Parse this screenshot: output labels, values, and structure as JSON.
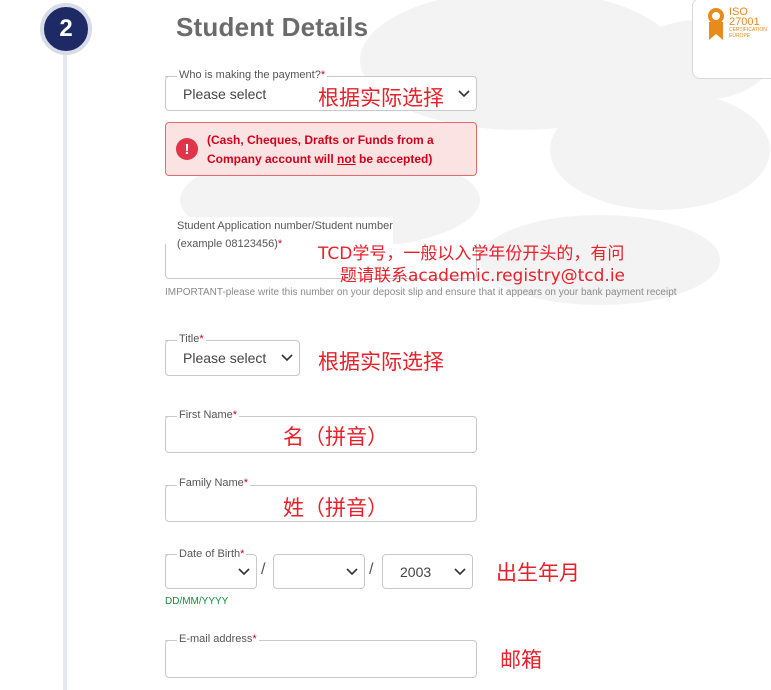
{
  "step": {
    "number": "2",
    "title": "Student Details"
  },
  "iso_badge": {
    "line1": "ISO",
    "line2": "27001",
    "line3": "CERTIFICATION",
    "line4": "EUROPE"
  },
  "payer": {
    "label": "Who is making the payment?",
    "required_mark": "*",
    "selected": "Please select",
    "annotation": "根据实际选择"
  },
  "alert": {
    "icon": "!",
    "text_before": "(Cash, Cheques, Drafts or Funds from a Company account will ",
    "text_emph": "not",
    "text_after": " be accepted)"
  },
  "student_number": {
    "label_line1": "Student Application number/Student number",
    "label_line2": "(example 08123456)",
    "required_mark": "*",
    "value": "",
    "help": "IMPORTANT-please write this number on your deposit slip and ensure that it appears on your bank payment receipt",
    "annotation_line1": "TCD学号，一般以入学年份开头的，有问",
    "annotation_line2": "题请联系academic.registry@tcd.ie"
  },
  "title_field": {
    "label": "Title",
    "required_mark": "*",
    "selected": "Please select",
    "annotation": "根据实际选择"
  },
  "first_name": {
    "label": "First Name",
    "required_mark": "*",
    "value": "",
    "annotation": "名（拼音）"
  },
  "family_name": {
    "label": "Family Name",
    "required_mark": "*",
    "value": "",
    "annotation": "姓（拼音）"
  },
  "dob": {
    "label": "Date of Birth",
    "required_mark": "*",
    "day": "",
    "month": "",
    "year": "2003",
    "separator": "/",
    "format_hint": "DD/MM/YYYY",
    "annotation": "出生年月"
  },
  "email": {
    "label": "E-mail address",
    "required_mark": "*",
    "value": "",
    "annotation": "邮箱"
  },
  "colors": {
    "navy": "#1e2a66",
    "error_red": "#d0021b",
    "annotation_red": "#e8202a",
    "hint_green": "#1a8a3a",
    "iso_orange": "#e98a1c"
  }
}
